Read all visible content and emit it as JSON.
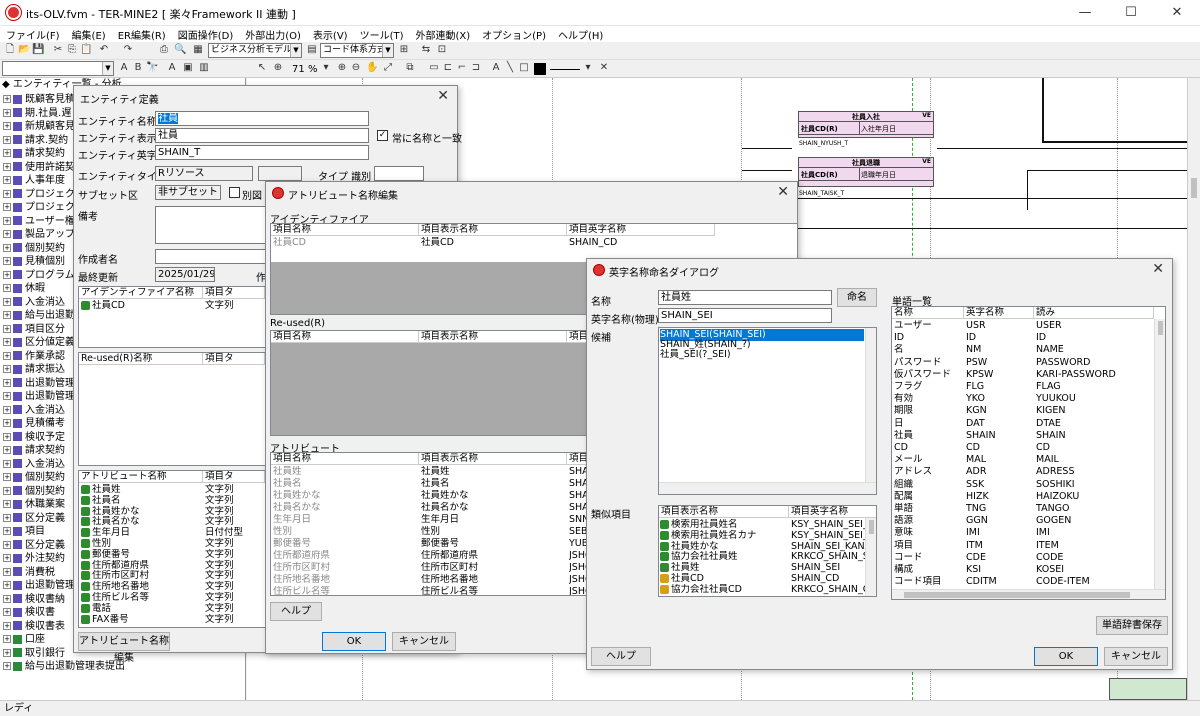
{
  "window": {
    "title": "its-OLV.fvm - TER-MINE2 [ 楽々Framework II 連動 ]"
  },
  "menu": [
    "ファイル(F)",
    "編集(E)",
    "ER編集(R)",
    "図面操作(D)",
    "外部出力(O)",
    "表示(V)",
    "ツール(T)",
    "外部連動(X)",
    "オプション(P)",
    "ヘルプ(H)"
  ],
  "toolbar": {
    "model_combo": "ビジネス分析モデル",
    "code_combo": "コード体系方式",
    "zoom": "71",
    "zoom_unit": "%"
  },
  "tree": {
    "header": "◆ エンティティ一覧 - 分析",
    "items": [
      "既顧客見積",
      "期.社員.遅",
      "新規顧客見",
      "請求.契約",
      "請求契約",
      "使用許諾契",
      "人事年度",
      "プロジェクト",
      "プロジェクト",
      "ユーザー権限",
      "製品アップ",
      "個別契約",
      "見積個別",
      "プログラム",
      "休暇",
      "入金消込",
      "給与出退勤",
      "項目区分",
      "区分値定義",
      "作業承認",
      "請求振込",
      "出退勤管理",
      "出退勤管理",
      "入金消込",
      "見積備考",
      "検収予定",
      "請求契約",
      "入金消込",
      "個別契約",
      "個別契約",
      "休職業案",
      "区分定義",
      "項目",
      "区分定義",
      "外注契約",
      "消費税",
      "出退勤管理",
      "検収書納",
      "検収書",
      "検収書表",
      "口座",
      "取引銀行",
      "給与出退勤管理表提出"
    ]
  },
  "canvas": {
    "entities": [
      {
        "name": "社員入社",
        "tag": "VE",
        "key": "社員CD(R)",
        "attr": "入社年月日",
        "physical": "SHAIN_NYUSH_T"
      },
      {
        "name": "社員退職",
        "tag": "VE",
        "key": "社員CD(R)",
        "attr": "退職年月日",
        "physical": "SHAIN_TAISK_T"
      }
    ]
  },
  "entity_dialog": {
    "title": "エンティティ定義",
    "labels": {
      "name": "エンティティ名称",
      "display": "エンティティ表示名",
      "english": "エンティティ英字名",
      "type": "エンティティタイ",
      "subset": "サブセット区",
      "note": "備考",
      "author": "作成者名",
      "updated": "最終更新",
      "type_id": "タイプ 識別",
      "sync": "常に名称と一致",
      "alias": "別図",
      "creator_short": "作"
    },
    "values": {
      "name": "社員",
      "display": "社員",
      "english": "SHAIN_T",
      "type": "Rリソース",
      "subset": "非サブセット",
      "updated": "2025/01/29"
    },
    "id_list": {
      "headers": [
        "アイデンティファイア名称",
        "項目タ"
      ],
      "rows": [
        [
          "社員CD",
          "文字列"
        ]
      ]
    },
    "reused_list": {
      "headers": [
        "Re-used(R)名称",
        "項目タ"
      ]
    },
    "attr_list": {
      "headers": [
        "アトリビュート名称",
        "項目タ"
      ],
      "rows": [
        [
          "社員姓",
          "文字列"
        ],
        [
          "社員名",
          "文字列"
        ],
        [
          "社員姓かな",
          "文字列"
        ],
        [
          "社員名かな",
          "文字列"
        ],
        [
          "生年月日",
          "日付付型"
        ],
        [
          "性別",
          "文字列"
        ],
        [
          "郵便番号",
          "文字列"
        ],
        [
          "住所都道府県",
          "文字列"
        ],
        [
          "住所市区町村",
          "文字列"
        ],
        [
          "住所地名番地",
          "文字列"
        ],
        [
          "住所ビル名等",
          "文字列"
        ],
        [
          "電話",
          "文字列"
        ],
        [
          "FAX番号",
          "文字列"
        ]
      ]
    },
    "attr_edit_button": "アトリビュート名称編集"
  },
  "attr_dialog": {
    "title": "アトリビュート名称編集",
    "section_id": "アイデンティファイア",
    "section_reused": "Re-used(R)",
    "section_attr": "アトリビュート",
    "headers": [
      "項目名称",
      "項目表示名称",
      "項目英字名称"
    ],
    "id_rows": [
      [
        "社員CD",
        "社員CD",
        "SHAIN_CD"
      ]
    ],
    "attr_rows": [
      [
        "社員姓",
        "社員姓",
        "SHAI"
      ],
      [
        "社員名",
        "社員名",
        "SHAI"
      ],
      [
        "社員姓かな",
        "社員姓かな",
        "SHAI"
      ],
      [
        "社員名かな",
        "社員名かな",
        "SHAI"
      ],
      [
        "生年月日",
        "生年月日",
        "SNN"
      ],
      [
        "性別",
        "性別",
        "SEBE"
      ],
      [
        "郵便番号",
        "郵便番号",
        "YUB"
      ],
      [
        "住所都道府県",
        "住所都道府県",
        "JSHO"
      ],
      [
        "住所市区町村",
        "住所市区町村",
        "JSHO"
      ],
      [
        "住所地名番地",
        "住所地名番地",
        "JSHO"
      ],
      [
        "住所ビル名等",
        "住所ビル名等",
        "JSHO"
      ]
    ],
    "help": "ヘルプ",
    "ok": "OK",
    "cancel": "キャンセル"
  },
  "eng_dialog": {
    "title": "英字名称命名ダイアログ",
    "labels": {
      "name": "名称",
      "physical": "英字名称(物理)",
      "candidates": "候補",
      "similar": "類似項目",
      "dict": "単語一覧"
    },
    "values": {
      "name": "社員姓",
      "physical": "SHAIN_SEI"
    },
    "name_button": "命名",
    "candidates": [
      "SHAIN_SEI(SHAIN_SEI)",
      "SHAIN_姓(SHAIN_?)",
      "社員_SEI(?_SEI)"
    ],
    "similar_headers": [
      "項目表示名称",
      "項目英字名称"
    ],
    "similar_rows": [
      [
        "検索用社員姓名",
        "KSY_SHAIN_SEI_M",
        "a"
      ],
      [
        "検索用社員姓名カナ",
        "KSY_SHAIN_SEI_M",
        "a"
      ],
      [
        "社員姓かな",
        "SHAIN_SEI_KANA",
        "a"
      ],
      [
        "協力会社社員姓",
        "KRKCO_SHAIN_SE",
        "a"
      ],
      [
        "社員姓",
        "SHAIN_SEI",
        "a"
      ],
      [
        "社員CD",
        "SHAIN_CD",
        "k"
      ],
      [
        "協力会社社員CD",
        "KRKCO_SHAIN_CD",
        "k"
      ]
    ],
    "dict_headers": [
      "名称",
      "英字名称",
      "読み"
    ],
    "dict_rows": [
      [
        "ユーザー",
        "USR",
        "USER"
      ],
      [
        "ID",
        "ID",
        "ID"
      ],
      [
        "名",
        "NM",
        "NAME"
      ],
      [
        "パスワード",
        "PSW",
        "PASSWORD"
      ],
      [
        "仮パスワード",
        "KPSW",
        "KARI-PASSWORD"
      ],
      [
        "フラグ",
        "FLG",
        "FLAG"
      ],
      [
        "有効",
        "YKO",
        "YUUKOU"
      ],
      [
        "期限",
        "KGN",
        "KIGEN"
      ],
      [
        "日",
        "DAT",
        "DTAE"
      ],
      [
        "社員",
        "SHAIN",
        "SHAIN"
      ],
      [
        "CD",
        "CD",
        "CD"
      ],
      [
        "メール",
        "MAL",
        "MAIL"
      ],
      [
        "アドレス",
        "ADR",
        "ADRESS"
      ],
      [
        "組織",
        "SSK",
        "SOSHIKI"
      ],
      [
        "配属",
        "HIZK",
        "HAIZOKU"
      ],
      [
        "単語",
        "TNG",
        "TANGO"
      ],
      [
        "語源",
        "GGN",
        "GOGEN"
      ],
      [
        "意味",
        "IMI",
        "IMI"
      ],
      [
        "項目",
        "ITM",
        "ITEM"
      ],
      [
        "コード",
        "CDE",
        "CODE"
      ],
      [
        "構成",
        "KSI",
        "KOSEI"
      ],
      [
        "コード項目",
        "CDITM",
        "CODE-ITEM"
      ]
    ],
    "save_dict": "単語辞書保存",
    "help": "ヘルプ",
    "ok": "OK",
    "cancel": "キャンセル"
  },
  "status": "レディ"
}
